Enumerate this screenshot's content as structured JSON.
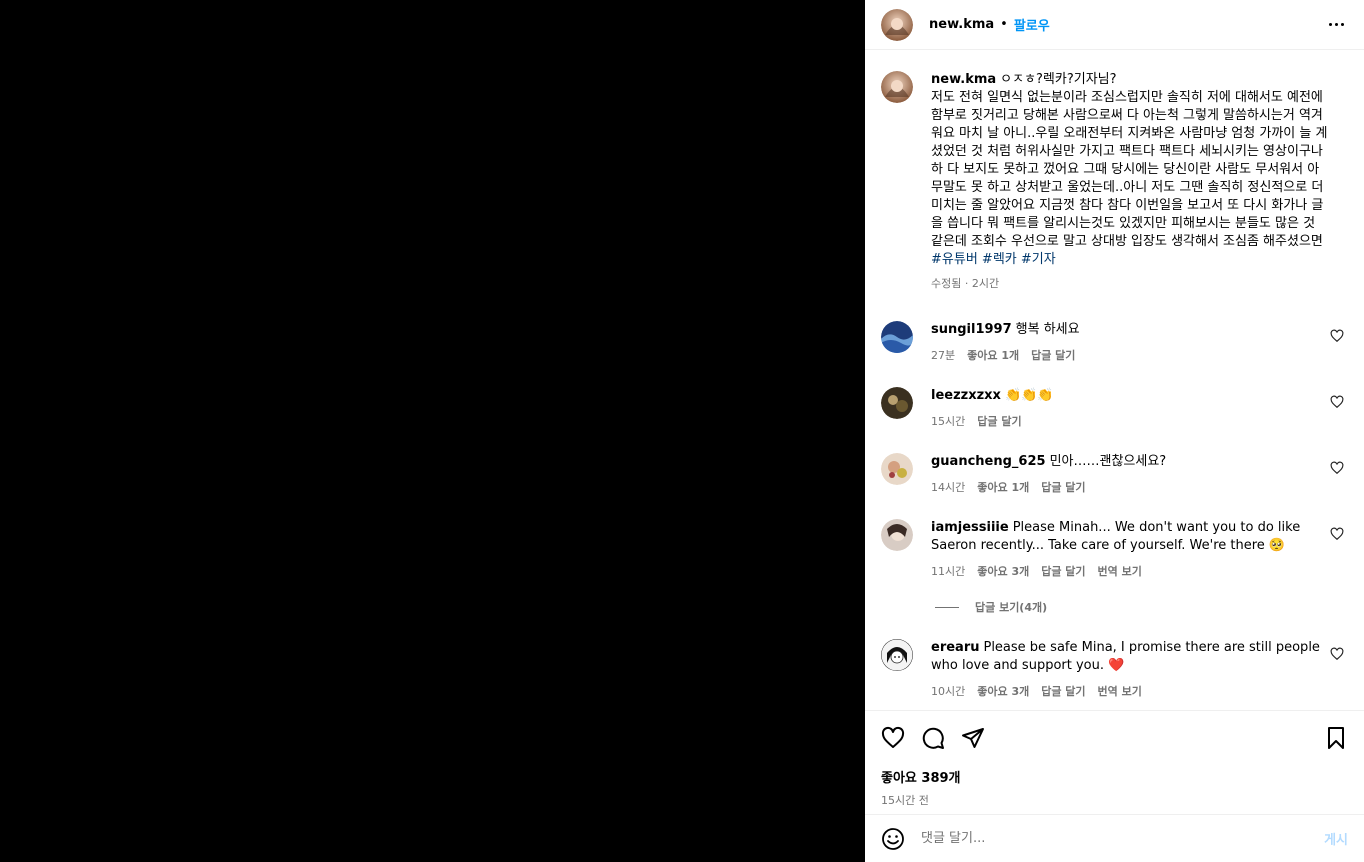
{
  "post": {
    "author": "new.kma",
    "follow_label": "팔로우",
    "separator": "•",
    "caption": {
      "head": "ㅇㅈㅎ?렉카?기자님?",
      "text": "저도 전혀 일면식 없는분이라 조심스럽지만 솔직히 저에 대해서도 예전에 함부로 짓거리고 당해본 사람으로써 다 아는척 그렇게 말씀하시는거 역겨워요 마치 날 아니..우릴 오래전부터 지켜봐온 사람마냥 엄청 가까이 늘 계셨었던 것 처럼 허위사실만 가지고 팩트다 팩트다 세뇌시키는 영상이구나 하 다 보지도 못하고 껐어요 그때 당시에는 당신이란 사람도 무서워서 아무말도 못 하고 상처받고 울었는데..아니 저도 그땐 솔직히 정신적으로 더 미치는 줄 알았어요 지금껏 참다 참다 이번일을 보고서 또 다시 화가나 글을 씁니다 뭐 팩트를 알리시는것도 있겠지만 피해보시는 분들도 많은 것 같은데 조회수 우선으로 말고 상대방 입장도 생각해서 조심좀 해주셨으면 ",
      "hashtags": [
        "#유튜버",
        "#렉카",
        "#기자"
      ],
      "meta": "수정됨 · 2시간"
    },
    "comments": [
      {
        "user": "sungil1997",
        "text": "행복 하세요",
        "time": "27분",
        "likes": "좋아요 1개",
        "reply": "답글 달기"
      },
      {
        "user": "leezzxzxx",
        "text": "👏👏👏",
        "time": "15시간",
        "likes": "",
        "reply": "답글 달기"
      },
      {
        "user": "guancheng_625",
        "text": "민아……괜찮으세요?",
        "time": "14시간",
        "likes": "좋아요 1개",
        "reply": "답글 달기"
      },
      {
        "user": "iamjessiiie",
        "text": "Please Minah... We don't want you to do like Saeron recently... Take care of yourself. We're there 🥺",
        "time": "11시간",
        "likes": "좋아요 3개",
        "reply": "답글 달기",
        "translate": "번역 보기"
      },
      {
        "user": "erearu",
        "text": "Please be safe Mina, I promise there are still people who love and support you. ❤️",
        "time": "10시간",
        "likes": "좋아요 3개",
        "reply": "답글 달기",
        "translate": "번역 보기"
      }
    ],
    "view_replies": "답글 보기(4개)",
    "likes": "좋아요 389개",
    "posted": "15시간 전",
    "add_comment": {
      "placeholder": "댓글 달기...",
      "post_label": "게시"
    }
  },
  "icons": [
    "more-icon",
    "heart-icon",
    "comment-icon",
    "share-icon",
    "bookmark-icon",
    "emoji-icon"
  ],
  "colors": {
    "link": "#0095f6",
    "hashtag": "#00376b",
    "muted": "#737373",
    "post_disabled": "#b3dbff"
  }
}
